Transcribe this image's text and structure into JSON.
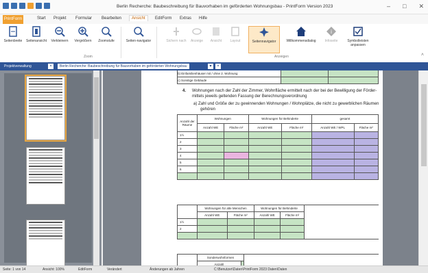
{
  "window": {
    "title": "Berlin Recherche: Baubeschreibung für Bauvorhaben im geförderten Wohnungsbau - PrintForm Version 2023"
  },
  "tabs": [
    "PrintForm",
    "Start",
    "Projekt",
    "Formular",
    "Bearbeiten",
    "Ansicht",
    "EditForm",
    "Extras",
    "Hilfe"
  ],
  "ribbon": {
    "buttons": [
      {
        "label": "Seitenbreite"
      },
      {
        "label": "Seitenansicht"
      },
      {
        "label": "Verkleinern"
      },
      {
        "label": "Vergrößern"
      },
      {
        "label": "Zoomstufe"
      },
      {
        "label": "Seiten-navigator"
      },
      {
        "label": "Sichern nach"
      },
      {
        "label": "Anzeige"
      },
      {
        "label": "Ansicht"
      },
      {
        "label": "Layout"
      },
      {
        "label": "Seitennavigator"
      },
      {
        "label": "Willkommensdialog"
      },
      {
        "label": "Infoseite"
      },
      {
        "label": "Symbolleisten anpassen"
      }
    ],
    "groups": {
      "zoom": "Zoom",
      "anzeigen": "Anzeigen"
    }
  },
  "doc_tabs": {
    "project": "Projektverwaltung",
    "document": "Berlin Recherche: Baubeschreibung für Bauvorhaben im geförderten Wohnungsbau"
  },
  "form": {
    "rows_top": [
      "b) Einfamilienhäuser mit / ohne 2. Wohnung",
      "c) Sonstige Gebäude"
    ],
    "section_number": "4.",
    "section_text_1": "Wohnungen nach der Zahl der Zimmer, Wohnfläche ermittelt nach der bei der Bewilligung der Förder-",
    "section_text_2": "mittels jeweils geltenden Fassung der Berechnungsverordnung",
    "sub_a_1": "a)  Zahl und Größe der zu gewinnenden Wohnungen / Wohnplätze, die nicht zu gewerblichen Räumen",
    "sub_a_2": "gehören",
    "table1": {
      "h_anzahl": "Anzahl der Räume",
      "h_wohnungen": "Wohnungen",
      "h_behinderte": "Wohnungen für Behinderte",
      "h_gesamt": "gesamt",
      "h_anzahl_we": "Anzahl WE",
      "h_flaeche": "Fläche m²",
      "h_anzahl_wpl": "Anzahl WE / WPL",
      "rooms": [
        "1½",
        "2",
        "3",
        "4",
        "5",
        "6",
        ""
      ]
    },
    "table2": {
      "h_alte": "Wohnungen für alte Menschen",
      "h_behinderte": "Wohnungen für Behinderte",
      "h_anzahl_we": "Anzahl WE",
      "h_flaeche": "Fläche m²",
      "rooms": [
        "1½",
        "2",
        ""
      ]
    },
    "table3": {
      "h_sonder": "Sonderwohnformen",
      "h_anzahl": "Anzahl"
    }
  },
  "status": {
    "page": "Seite: 1 von 14",
    "zoom": "Ansicht: 100%",
    "mode": "EditForm",
    "state": "Verändert",
    "info": "Änderungen ab Jahren",
    "path": "C:\\Benutzer\\Daten\\PrintForm 2023 Daten\\Daten"
  },
  "colors": {
    "accent": "#f0a030",
    "doc_tab_bar": "#2f5597",
    "cell_green": "#c6e4c4",
    "cell_purple": "#b9b3e3"
  }
}
